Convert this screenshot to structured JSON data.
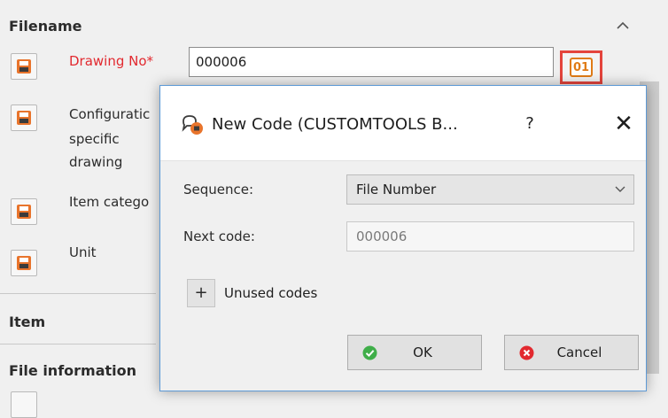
{
  "panel": {
    "sections": {
      "filename": "Filename",
      "item": "Item",
      "file_information": "File information"
    },
    "properties": [
      {
        "label": "Drawing No*",
        "required": true
      },
      {
        "label": "Configuratic",
        "label2": "specific",
        "label3": "drawing"
      },
      {
        "label": "Item catego"
      },
      {
        "label": "Unit"
      }
    ],
    "drawing_no_value": "000006",
    "code_button_label": "01"
  },
  "dialog": {
    "title": "New Code (CUSTOMTOOLS B...",
    "help": "?",
    "close": "✕",
    "sequence_label": "Sequence:",
    "sequence_value": "File Number",
    "next_code_label": "Next code:",
    "next_code_value": "000006",
    "expand_symbol": "+",
    "unused_codes_label": "Unused codes",
    "ok_label": "OK",
    "cancel_label": "Cancel"
  },
  "colors": {
    "required_label": "#e2292f",
    "code_button_border": "#e4443c",
    "code_icon": "#e07b16",
    "ok_icon": "#3fae49",
    "cancel_icon": "#e2292f",
    "dialog_border": "#5e9ad6"
  }
}
